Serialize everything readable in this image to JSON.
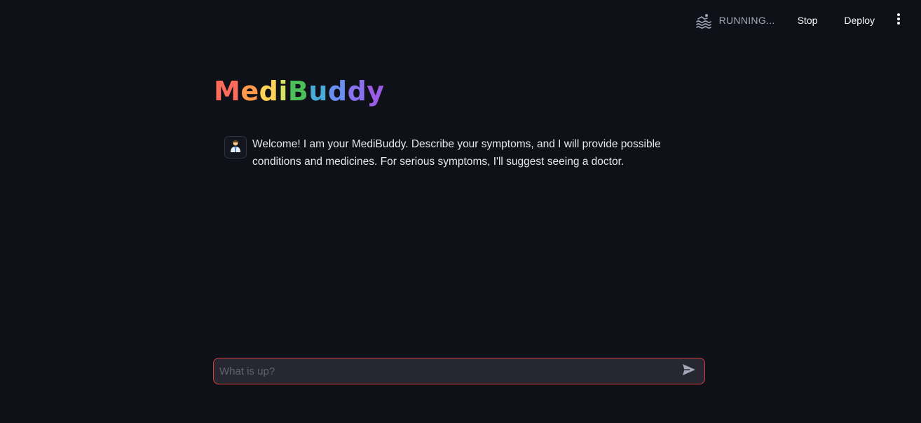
{
  "header": {
    "status_text": "RUNNING...",
    "stop_label": "Stop",
    "deploy_label": "Deploy",
    "status_icon": "swimmer-icon",
    "menu_icon": "vertical-dots-icon"
  },
  "title": {
    "text": "MediBuddy",
    "letters": [
      "M",
      "e",
      "d",
      "i",
      "B",
      "u",
      "d",
      "d",
      "y"
    ],
    "letter_colors": [
      "#ff6b5b",
      "#ff9a4d",
      "#ffd25a",
      "#d7e363",
      "#4cbe5a",
      "#4aa9d6",
      "#6b8ff0",
      "#8a72ee",
      "#9b5de5"
    ]
  },
  "messages": [
    {
      "role": "assistant",
      "avatar_icon": "doctor-icon",
      "text": "Welcome! I am your MediBuddy. Describe your symptoms, and I will provide possible conditions and medicines. For serious symptoms, I'll suggest seeing a doctor."
    }
  ],
  "chat_input": {
    "placeholder": "What is up?",
    "value": "",
    "send_icon": "send-icon"
  },
  "colors": {
    "background": "#0e1117",
    "input_border": "#e0393e",
    "input_bg": "#262730"
  }
}
